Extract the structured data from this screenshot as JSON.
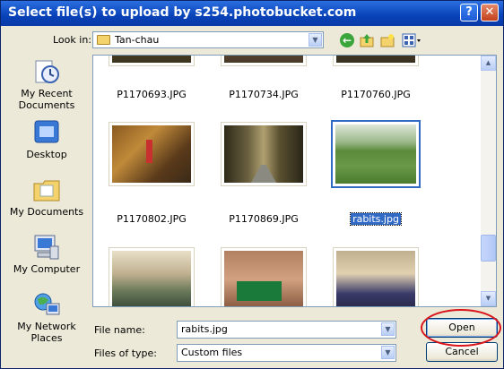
{
  "window": {
    "title": "Select file(s) to upload by s254.photobucket.com",
    "help_glyph": "?",
    "close_glyph": "✕"
  },
  "toolbar": {
    "look_in_label": "Look in:",
    "look_in_value": "Tan-chau"
  },
  "places": [
    {
      "label": "My Recent Documents",
      "icon": "recent-documents-icon"
    },
    {
      "label": "Desktop",
      "icon": "desktop-icon"
    },
    {
      "label": "My Documents",
      "icon": "my-documents-icon"
    },
    {
      "label": "My Computer",
      "icon": "my-computer-icon"
    },
    {
      "label": "My Network Places",
      "icon": "network-places-icon"
    }
  ],
  "files": [
    {
      "name": "P1170693.JPG",
      "selected": false
    },
    {
      "name": "P1170734.JPG",
      "selected": false
    },
    {
      "name": "P1170760.JPG",
      "selected": false
    },
    {
      "name": "P1170802.JPG",
      "selected": false
    },
    {
      "name": "P1170869.JPG",
      "selected": false
    },
    {
      "name": "rabits.jpg",
      "selected": true
    },
    {
      "name": "",
      "selected": false
    },
    {
      "name": "",
      "selected": false
    },
    {
      "name": "",
      "selected": false
    }
  ],
  "filename": {
    "label": "File name:",
    "value": "rabits.jpg"
  },
  "filetype": {
    "label": "Files of type:",
    "value": "Custom files"
  },
  "buttons": {
    "open": "Open",
    "cancel": "Cancel"
  },
  "colors": {
    "accent": "#316ac5",
    "titlebar": "#0842b8",
    "highlight_circle": "#d9151b"
  }
}
